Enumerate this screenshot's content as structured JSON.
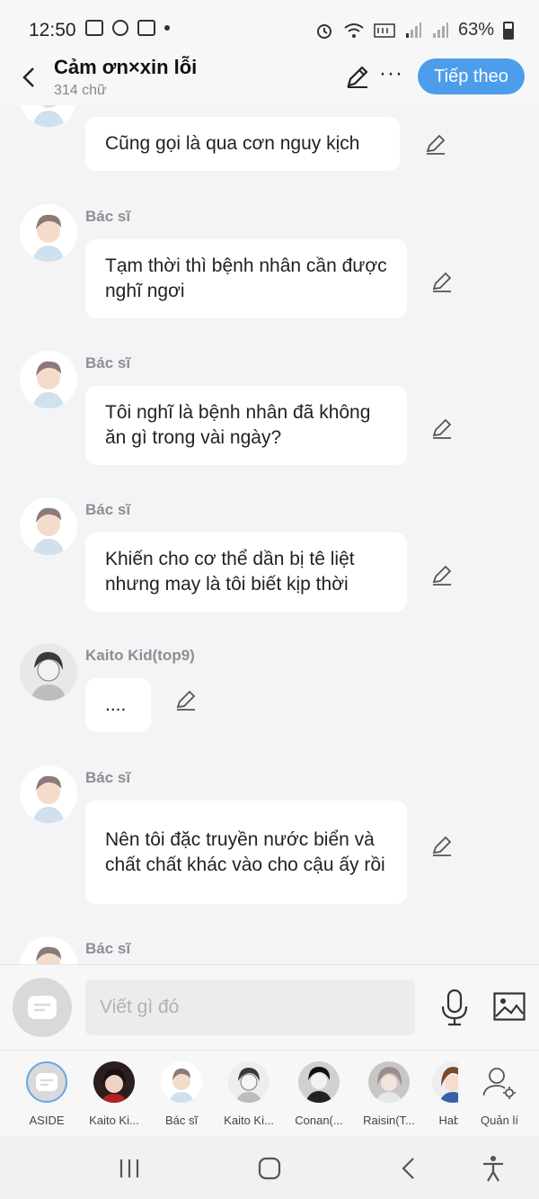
{
  "status_bar": {
    "time": "12:50",
    "battery": "63%",
    "battery_level": 0.63,
    "left_icons": [
      "gallery-icon",
      "sync-icon",
      "laz-icon"
    ],
    "right_icons": [
      "alarm-icon",
      "wifi-icon",
      "volte-icon",
      "signal-icon",
      "signal-icon"
    ]
  },
  "header": {
    "title": "Cảm ơn×xin lỗi",
    "subtitle": "314 chữ",
    "next_label": "Tiếp theo",
    "more_label": "···"
  },
  "messages": [
    {
      "sender": "",
      "avatar": "doctor",
      "text": "Cũng gọi là qua cơn nguy kịch"
    },
    {
      "sender": "Bác sĩ",
      "avatar": "doctor",
      "text": "Tạm thời thì bệnh nhân cần được nghĩ ngơi"
    },
    {
      "sender": "Bác sĩ",
      "avatar": "doctor",
      "text": "Tôi nghĩ là bệnh nhân đã không ăn gì trong vài ngày?"
    },
    {
      "sender": "Bác sĩ",
      "avatar": "doctor",
      "text": "Khiến cho cơ thể dần bị tê liệt nhưng may là tôi biết kịp thời"
    },
    {
      "sender": "Kaito Kid(top9)",
      "avatar": "kaito",
      "text": "...."
    },
    {
      "sender": "Bác sĩ",
      "avatar": "doctor",
      "text": "Nên tôi đặc truyền nước biển và chất chất khác vào cho cậu ấy rồi"
    },
    {
      "sender": "Bác sĩ",
      "avatar": "doctor",
      "text": ""
    }
  ],
  "input": {
    "placeholder": "Viết gì đó"
  },
  "characters": [
    {
      "label": "ASIDE",
      "avatar": "aside"
    },
    {
      "label": "Kaito Ki...",
      "avatar": "dark-hair"
    },
    {
      "label": "Bác sĩ",
      "avatar": "doctor"
    },
    {
      "label": "Kaito Ki...",
      "avatar": "kaito"
    },
    {
      "label": "Conan(...",
      "avatar": "conan"
    },
    {
      "label": "Raisin(T...",
      "avatar": "raisin"
    },
    {
      "label": "Haba",
      "avatar": "haba"
    },
    {
      "label": "Quản lí",
      "avatar": "manage"
    }
  ],
  "colors": {
    "accent": "#4c9eea",
    "bubble": "#ffffff",
    "background": "#f4f4f6",
    "name": "#8e8e93"
  }
}
